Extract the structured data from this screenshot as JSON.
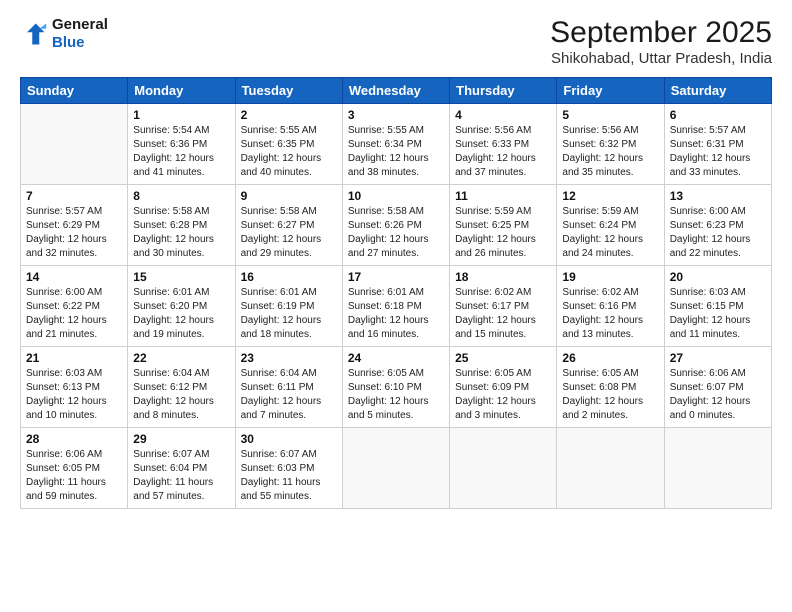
{
  "logo": {
    "line1": "General",
    "line2": "Blue"
  },
  "header": {
    "month": "September 2025",
    "location": "Shikohabad, Uttar Pradesh, India"
  },
  "weekdays": [
    "Sunday",
    "Monday",
    "Tuesday",
    "Wednesday",
    "Thursday",
    "Friday",
    "Saturday"
  ],
  "weeks": [
    [
      {
        "day": "",
        "info": ""
      },
      {
        "day": "1",
        "info": "Sunrise: 5:54 AM\nSunset: 6:36 PM\nDaylight: 12 hours\nand 41 minutes."
      },
      {
        "day": "2",
        "info": "Sunrise: 5:55 AM\nSunset: 6:35 PM\nDaylight: 12 hours\nand 40 minutes."
      },
      {
        "day": "3",
        "info": "Sunrise: 5:55 AM\nSunset: 6:34 PM\nDaylight: 12 hours\nand 38 minutes."
      },
      {
        "day": "4",
        "info": "Sunrise: 5:56 AM\nSunset: 6:33 PM\nDaylight: 12 hours\nand 37 minutes."
      },
      {
        "day": "5",
        "info": "Sunrise: 5:56 AM\nSunset: 6:32 PM\nDaylight: 12 hours\nand 35 minutes."
      },
      {
        "day": "6",
        "info": "Sunrise: 5:57 AM\nSunset: 6:31 PM\nDaylight: 12 hours\nand 33 minutes."
      }
    ],
    [
      {
        "day": "7",
        "info": "Sunrise: 5:57 AM\nSunset: 6:29 PM\nDaylight: 12 hours\nand 32 minutes."
      },
      {
        "day": "8",
        "info": "Sunrise: 5:58 AM\nSunset: 6:28 PM\nDaylight: 12 hours\nand 30 minutes."
      },
      {
        "day": "9",
        "info": "Sunrise: 5:58 AM\nSunset: 6:27 PM\nDaylight: 12 hours\nand 29 minutes."
      },
      {
        "day": "10",
        "info": "Sunrise: 5:58 AM\nSunset: 6:26 PM\nDaylight: 12 hours\nand 27 minutes."
      },
      {
        "day": "11",
        "info": "Sunrise: 5:59 AM\nSunset: 6:25 PM\nDaylight: 12 hours\nand 26 minutes."
      },
      {
        "day": "12",
        "info": "Sunrise: 5:59 AM\nSunset: 6:24 PM\nDaylight: 12 hours\nand 24 minutes."
      },
      {
        "day": "13",
        "info": "Sunrise: 6:00 AM\nSunset: 6:23 PM\nDaylight: 12 hours\nand 22 minutes."
      }
    ],
    [
      {
        "day": "14",
        "info": "Sunrise: 6:00 AM\nSunset: 6:22 PM\nDaylight: 12 hours\nand 21 minutes."
      },
      {
        "day": "15",
        "info": "Sunrise: 6:01 AM\nSunset: 6:20 PM\nDaylight: 12 hours\nand 19 minutes."
      },
      {
        "day": "16",
        "info": "Sunrise: 6:01 AM\nSunset: 6:19 PM\nDaylight: 12 hours\nand 18 minutes."
      },
      {
        "day": "17",
        "info": "Sunrise: 6:01 AM\nSunset: 6:18 PM\nDaylight: 12 hours\nand 16 minutes."
      },
      {
        "day": "18",
        "info": "Sunrise: 6:02 AM\nSunset: 6:17 PM\nDaylight: 12 hours\nand 15 minutes."
      },
      {
        "day": "19",
        "info": "Sunrise: 6:02 AM\nSunset: 6:16 PM\nDaylight: 12 hours\nand 13 minutes."
      },
      {
        "day": "20",
        "info": "Sunrise: 6:03 AM\nSunset: 6:15 PM\nDaylight: 12 hours\nand 11 minutes."
      }
    ],
    [
      {
        "day": "21",
        "info": "Sunrise: 6:03 AM\nSunset: 6:13 PM\nDaylight: 12 hours\nand 10 minutes."
      },
      {
        "day": "22",
        "info": "Sunrise: 6:04 AM\nSunset: 6:12 PM\nDaylight: 12 hours\nand 8 minutes."
      },
      {
        "day": "23",
        "info": "Sunrise: 6:04 AM\nSunset: 6:11 PM\nDaylight: 12 hours\nand 7 minutes."
      },
      {
        "day": "24",
        "info": "Sunrise: 6:05 AM\nSunset: 6:10 PM\nDaylight: 12 hours\nand 5 minutes."
      },
      {
        "day": "25",
        "info": "Sunrise: 6:05 AM\nSunset: 6:09 PM\nDaylight: 12 hours\nand 3 minutes."
      },
      {
        "day": "26",
        "info": "Sunrise: 6:05 AM\nSunset: 6:08 PM\nDaylight: 12 hours\nand 2 minutes."
      },
      {
        "day": "27",
        "info": "Sunrise: 6:06 AM\nSunset: 6:07 PM\nDaylight: 12 hours\nand 0 minutes."
      }
    ],
    [
      {
        "day": "28",
        "info": "Sunrise: 6:06 AM\nSunset: 6:05 PM\nDaylight: 11 hours\nand 59 minutes."
      },
      {
        "day": "29",
        "info": "Sunrise: 6:07 AM\nSunset: 6:04 PM\nDaylight: 11 hours\nand 57 minutes."
      },
      {
        "day": "30",
        "info": "Sunrise: 6:07 AM\nSunset: 6:03 PM\nDaylight: 11 hours\nand 55 minutes."
      },
      {
        "day": "",
        "info": ""
      },
      {
        "day": "",
        "info": ""
      },
      {
        "day": "",
        "info": ""
      },
      {
        "day": "",
        "info": ""
      }
    ]
  ]
}
